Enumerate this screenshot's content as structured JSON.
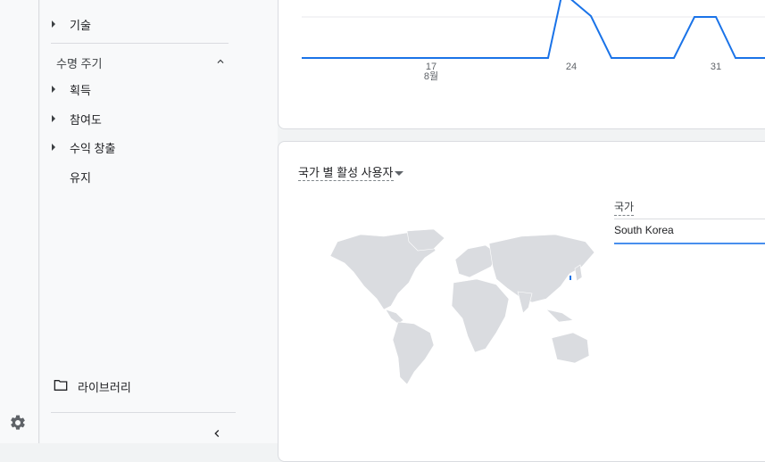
{
  "sidebar": {
    "items_top": [
      {
        "label": "기술"
      }
    ],
    "section_title": "수명 주기",
    "lifecycle_items": [
      {
        "label": "획득",
        "expandable": true
      },
      {
        "label": "참여도",
        "expandable": true
      },
      {
        "label": "수익 창출",
        "expandable": true
      },
      {
        "label": "유지",
        "expandable": false
      }
    ],
    "library_label": "라이브러리"
  },
  "timeseries": {
    "ticks": [
      {
        "day": "17",
        "month": "8월"
      },
      {
        "day": "24",
        "month": ""
      },
      {
        "day": "31",
        "month": ""
      }
    ]
  },
  "country_card": {
    "title": "국가 별 활성 사용자",
    "table_header": "국가",
    "rows": [
      {
        "country": "South Korea"
      }
    ]
  },
  "colors": {
    "accent": "#1a73e8",
    "map_land": "#dadce0",
    "highlight": "#1a73e8"
  },
  "icons": {
    "settings": "gear-icon",
    "folder": "folder-icon",
    "collapse": "chevron-left-icon"
  }
}
